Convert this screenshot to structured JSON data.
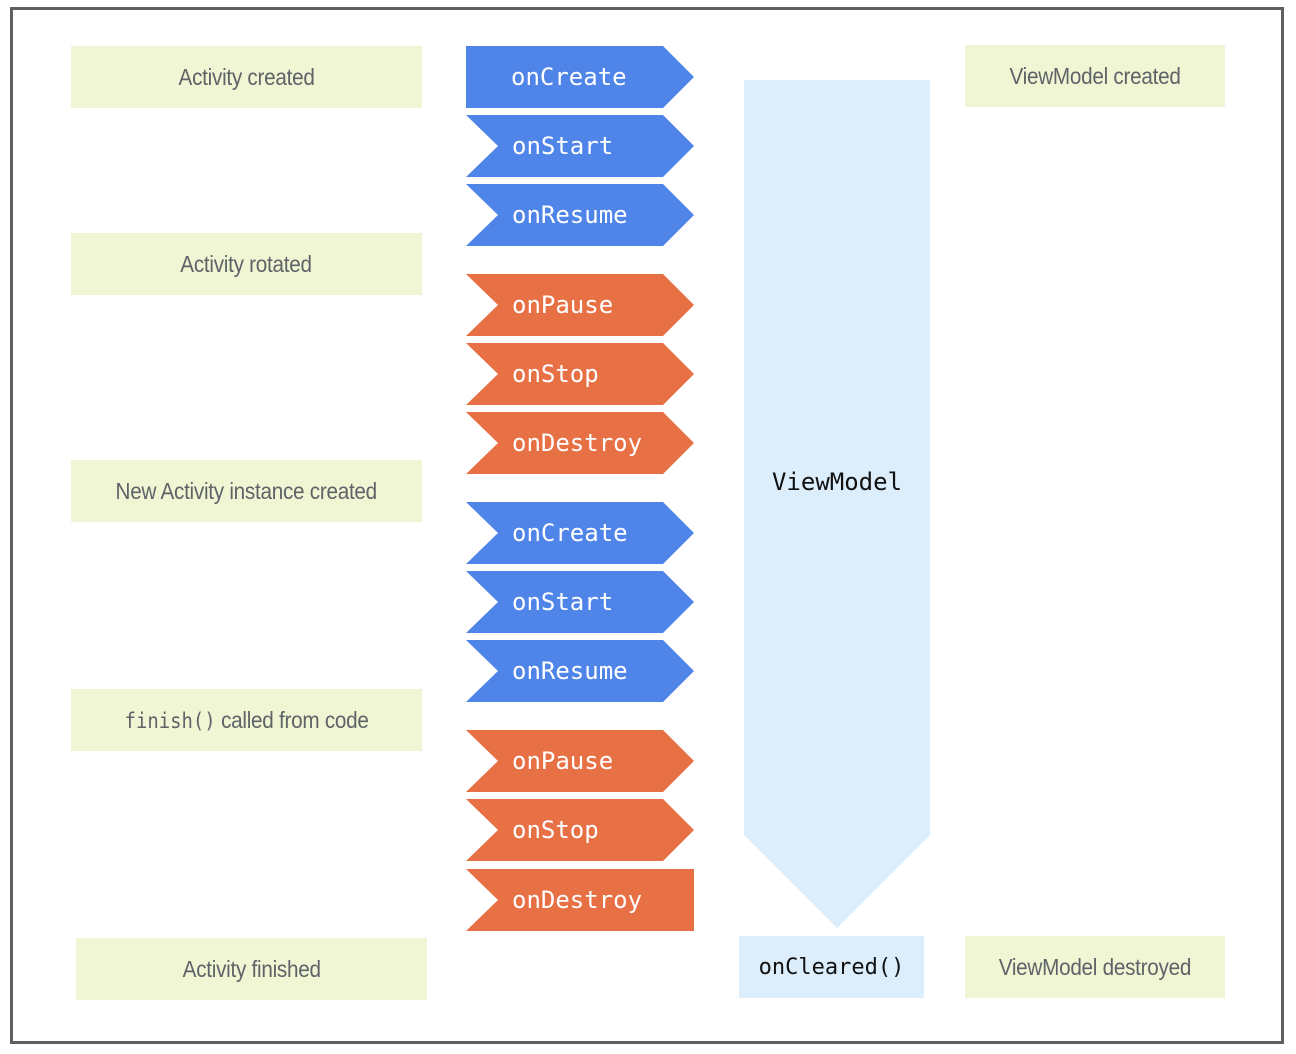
{
  "colors": {
    "start_events": "#4f84e8",
    "stop_events": "#e87045",
    "label_bg": "#f0f6d4",
    "viewmodel_bg": "#dcedfb",
    "label_text": "#5f6368"
  },
  "activity_labels": [
    {
      "text": "Activity created"
    },
    {
      "text": "Activity rotated"
    },
    {
      "text": "New Activity instance created"
    },
    {
      "code": "finish()",
      "text": " called from code"
    },
    {
      "text": "Activity finished"
    }
  ],
  "lifecycle_callbacks": [
    {
      "label": "onCreate",
      "kind": "start"
    },
    {
      "label": "onStart",
      "kind": "start"
    },
    {
      "label": "onResume",
      "kind": "start"
    },
    {
      "label": "onPause",
      "kind": "stop"
    },
    {
      "label": "onStop",
      "kind": "stop"
    },
    {
      "label": "onDestroy",
      "kind": "stop"
    },
    {
      "label": "onCreate",
      "kind": "start"
    },
    {
      "label": "onStart",
      "kind": "start"
    },
    {
      "label": "onResume",
      "kind": "start"
    },
    {
      "label": "onPause",
      "kind": "stop"
    },
    {
      "label": "onStop",
      "kind": "stop"
    },
    {
      "label": "onDestroy",
      "kind": "stop"
    }
  ],
  "viewmodel": {
    "label": "ViewModel",
    "cleared_label": "onCleared()"
  },
  "viewmodel_labels": {
    "created": "ViewModel created",
    "destroyed": "ViewModel destroyed"
  }
}
